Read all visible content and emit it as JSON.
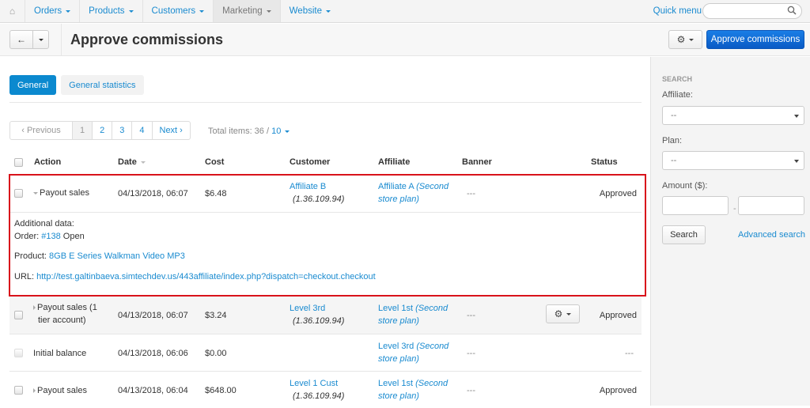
{
  "topnav": {
    "items": [
      {
        "label": "Orders",
        "active": false
      },
      {
        "label": "Products",
        "active": false
      },
      {
        "label": "Customers",
        "active": false
      },
      {
        "label": "Marketing",
        "active": true
      },
      {
        "label": "Website",
        "active": false
      }
    ],
    "quick_menu": "Quick menu",
    "search_placeholder": ""
  },
  "header": {
    "title": "Approve commissions",
    "approve_button": "Approve commissions"
  },
  "tabs": [
    {
      "label": "General",
      "active": true
    },
    {
      "label": "General statistics",
      "active": false
    }
  ],
  "pagination": {
    "previous": "‹ Previous",
    "pages": [
      "1",
      "2",
      "3",
      "4"
    ],
    "current": "1",
    "next": "Next ›",
    "total_label": "Total items: 36 / ",
    "per_page": "10"
  },
  "table": {
    "columns": [
      "Action",
      "Date",
      "Cost",
      "Customer",
      "Affiliate",
      "Banner",
      "Status"
    ],
    "rows": [
      {
        "action": "Payout sales",
        "expanded": true,
        "date": "04/13/2018, 06:07",
        "cost": "$6.48",
        "customer": "Affiliate B",
        "customer_ip": "(1.36.109.94)",
        "affiliate": "Affiliate A",
        "affiliate_plan_1": "(Second",
        "affiliate_plan_2": "store plan)",
        "banner": "---",
        "status": "Approved",
        "details": {
          "heading": "Additional data:",
          "order_label": "Order: ",
          "order_link": "#138",
          "order_status": " Open",
          "product_label": "Product: ",
          "product_link": "8GB E Series Walkman Video MP3",
          "url_label": "URL: ",
          "url_link": "http://test.galtinbaeva.simtechdev.us/443affiliate/index.php?dispatch=checkout.checkout"
        }
      },
      {
        "action_1": "Payout sales (1",
        "action_2": "tier account)",
        "expanded": false,
        "date": "04/13/2018, 06:07",
        "cost": "$3.24",
        "customer": "Level 3rd",
        "customer_ip": "(1.36.109.94)",
        "affiliate": "Level 1st",
        "affiliate_plan_1": "(Second",
        "affiliate_plan_2": "store plan)",
        "banner": "---",
        "status": "Approved"
      },
      {
        "action": "Initial balance",
        "date": "04/13/2018, 06:06",
        "cost": "$0.00",
        "customer": "",
        "customer_ip": "",
        "affiliate": "Level 3rd",
        "affiliate_plan_1": "(Second",
        "affiliate_plan_2": "store plan)",
        "banner": "---",
        "status": "---"
      },
      {
        "action": "Payout sales",
        "expanded": false,
        "date": "04/13/2018, 06:04",
        "cost": "$648.00",
        "customer": "Level 1 Cust",
        "customer_ip": "(1.36.109.94)",
        "affiliate": "Level 1st",
        "affiliate_plan_1": "(Second",
        "affiliate_plan_2": "store plan)",
        "banner": "---",
        "status": "Approved"
      }
    ]
  },
  "sidebar": {
    "title": "SEARCH",
    "affiliate_label": "Affiliate:",
    "affiliate_value": "--",
    "plan_label": "Plan:",
    "plan_value": "--",
    "amount_label": "Amount ($):",
    "amount_separator": "-",
    "search_button": "Search",
    "advanced_search": "Advanced search"
  },
  "colors": {
    "link": "#1a8bd0",
    "primary_button": "#0a5bc5",
    "active_tab": "#0b89cf",
    "highlight_border": "#d9121b"
  }
}
